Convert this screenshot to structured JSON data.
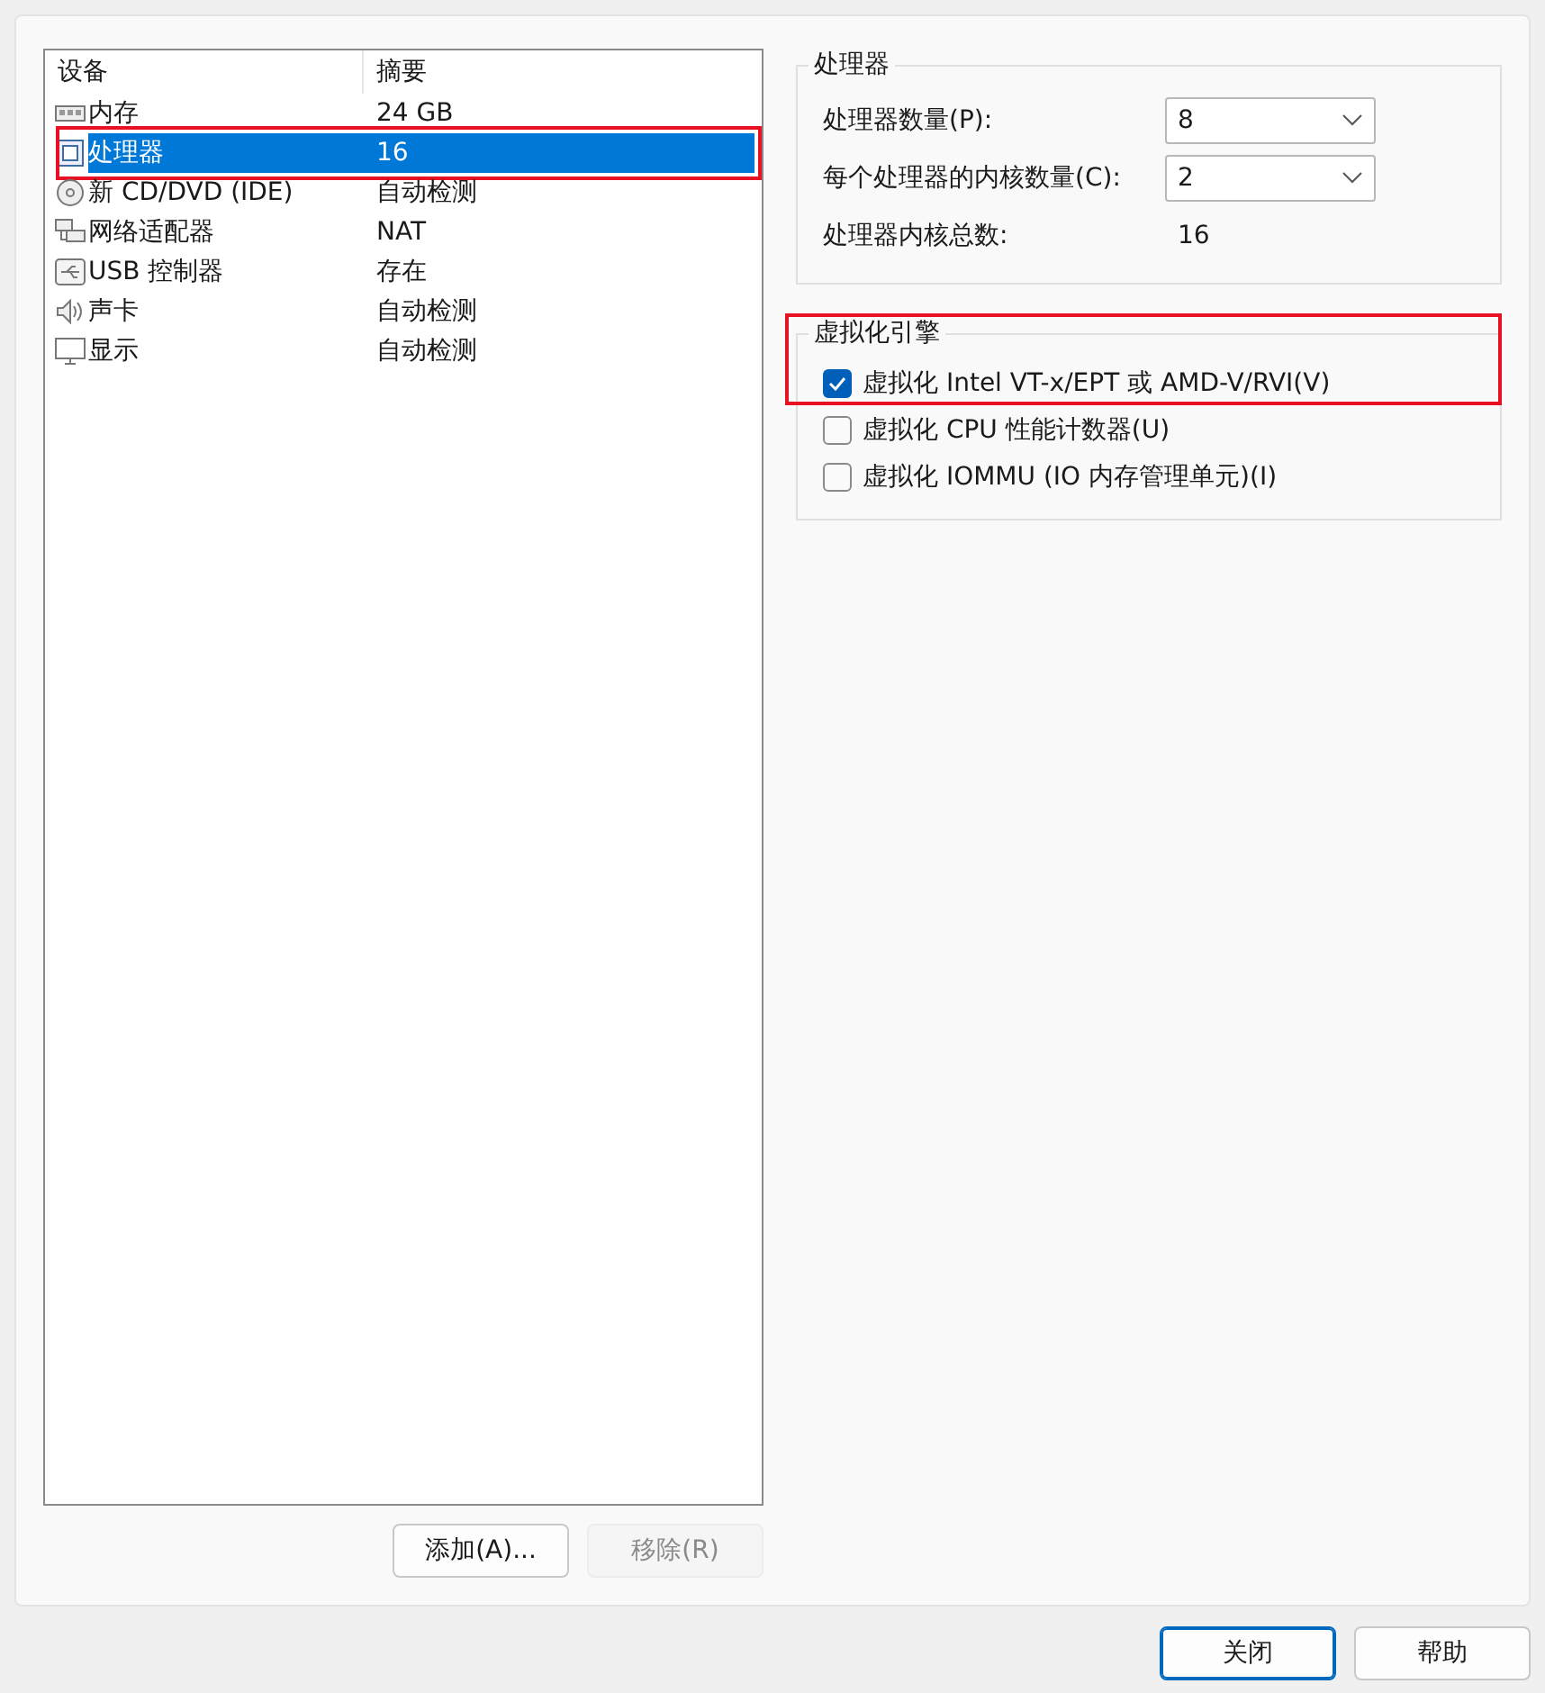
{
  "device_list": {
    "columns": [
      "设备",
      "摘要"
    ],
    "rows": [
      {
        "kind": "memory",
        "name": "内存",
        "summary": "24 GB",
        "selected": false,
        "highlighted": false
      },
      {
        "kind": "processor",
        "name": "处理器",
        "summary": "16",
        "selected": true,
        "highlighted": true
      },
      {
        "kind": "cdrom",
        "name": "新 CD/DVD (IDE)",
        "summary": "自动检测",
        "selected": false,
        "highlighted": false
      },
      {
        "kind": "network",
        "name": "网络适配器",
        "summary": "NAT",
        "selected": false,
        "highlighted": false
      },
      {
        "kind": "usb",
        "name": "USB 控制器",
        "summary": "存在",
        "selected": false,
        "highlighted": false
      },
      {
        "kind": "sound",
        "name": "声卡",
        "summary": "自动检测",
        "selected": false,
        "highlighted": false
      },
      {
        "kind": "display",
        "name": "显示",
        "summary": "自动检测",
        "selected": false,
        "highlighted": false
      }
    ]
  },
  "list_buttons": [
    {
      "label": "添加(A)...",
      "disabled": false
    },
    {
      "label": "移除(R)",
      "disabled": true
    }
  ],
  "processor_group": {
    "title": "处理器",
    "fields": [
      {
        "kind": "select",
        "label": "处理器数量(P):",
        "value": "8"
      },
      {
        "kind": "select",
        "label": "每个处理器的内核数量(C):",
        "value": "2"
      },
      {
        "kind": "readout",
        "label": "处理器内核总数:",
        "value": "16"
      }
    ]
  },
  "virtualization_group": {
    "title": "虚拟化引擎",
    "highlighted": true,
    "options": [
      {
        "label": "虚拟化 Intel VT-x/EPT 或 AMD-V/RVI(V)",
        "checked": true
      },
      {
        "label": "虚拟化 CPU 性能计数器(U)",
        "checked": false
      },
      {
        "label": "虚拟化 IOMMU (IO 内存管理单元)(I)",
        "checked": false
      }
    ]
  },
  "dialog_buttons": [
    {
      "label": "关闭",
      "default": true
    },
    {
      "label": "帮助",
      "default": false
    }
  ]
}
